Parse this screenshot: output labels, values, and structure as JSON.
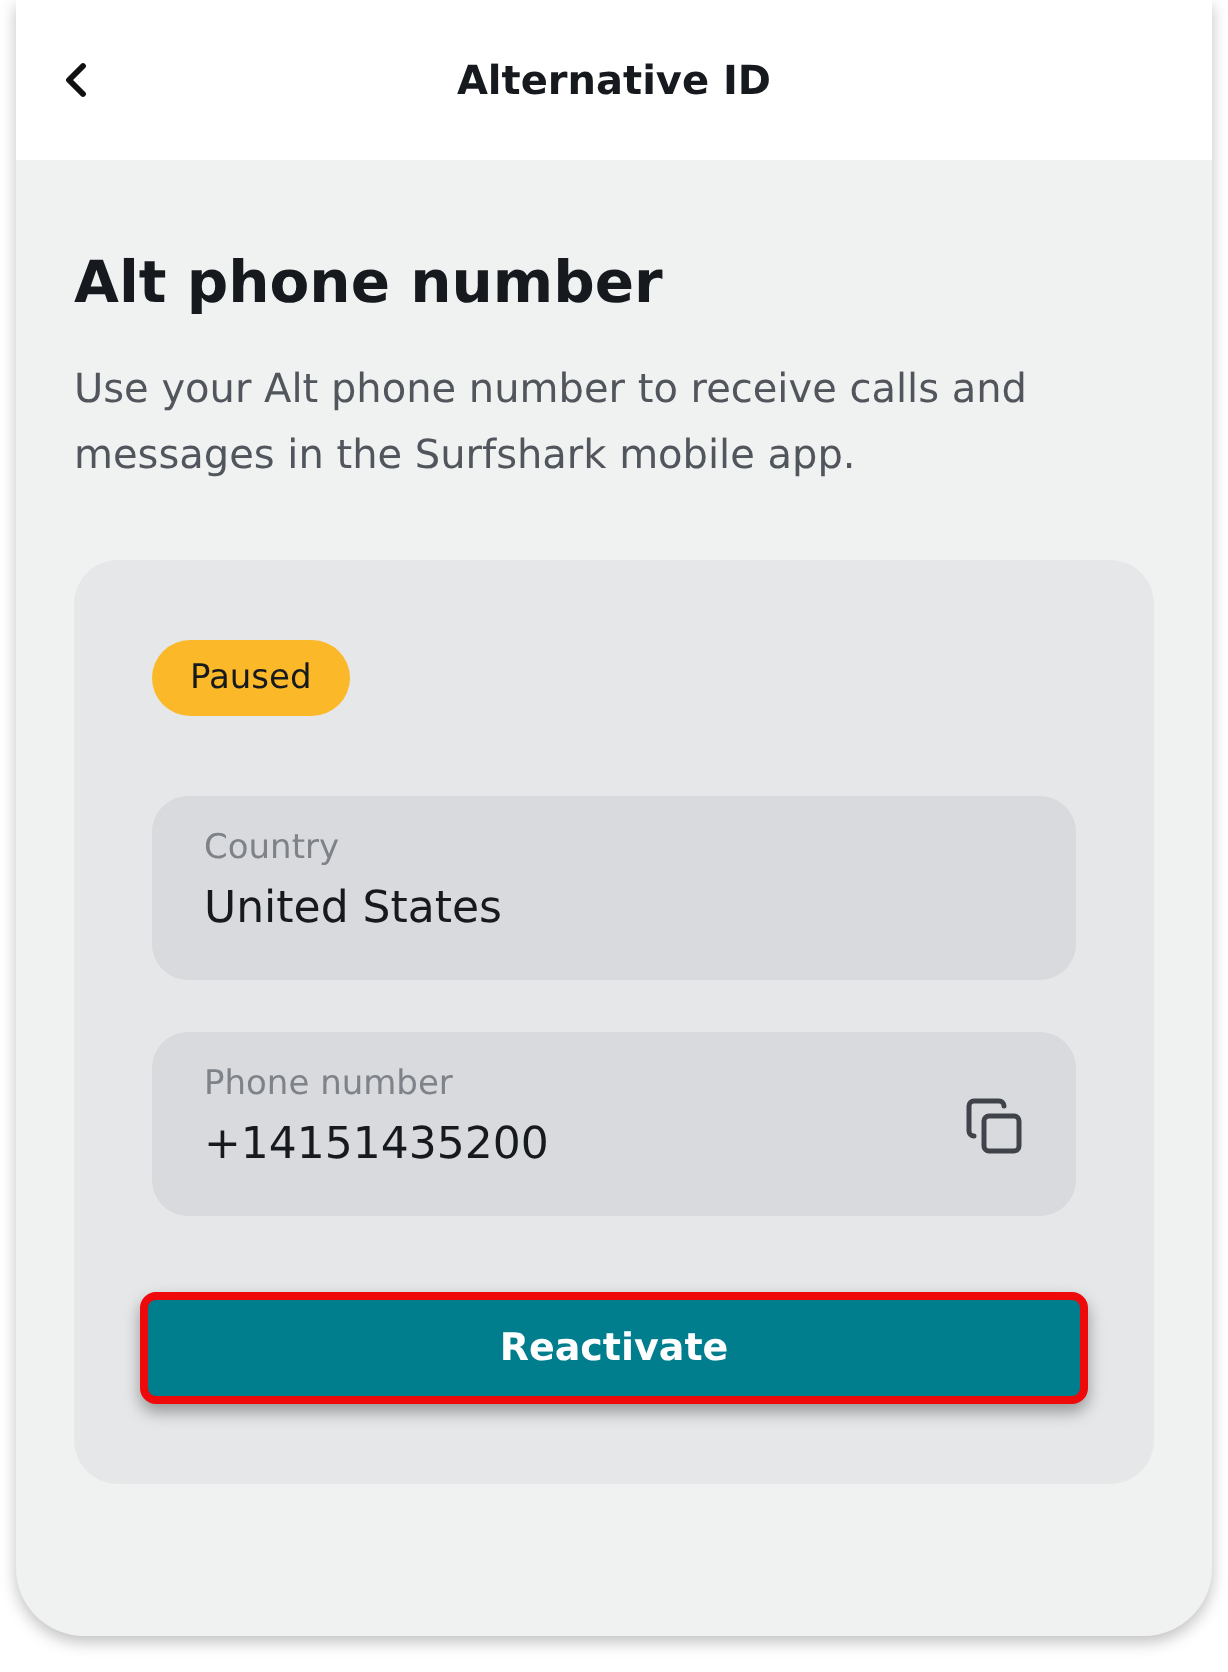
{
  "header": {
    "title": "Alternative ID"
  },
  "section": {
    "title": "Alt phone number",
    "description": "Use your Alt phone number to receive calls and messages in the Surfshark mobile app."
  },
  "status": {
    "label": "Paused",
    "color": "#fbb829"
  },
  "fields": [
    {
      "kind": "plain",
      "label": "Country",
      "value": "United States"
    },
    {
      "kind": "copyable",
      "label": "Phone number",
      "value": "+14151435200"
    }
  ],
  "button": {
    "label": "Reactivate",
    "highlighted": true
  }
}
